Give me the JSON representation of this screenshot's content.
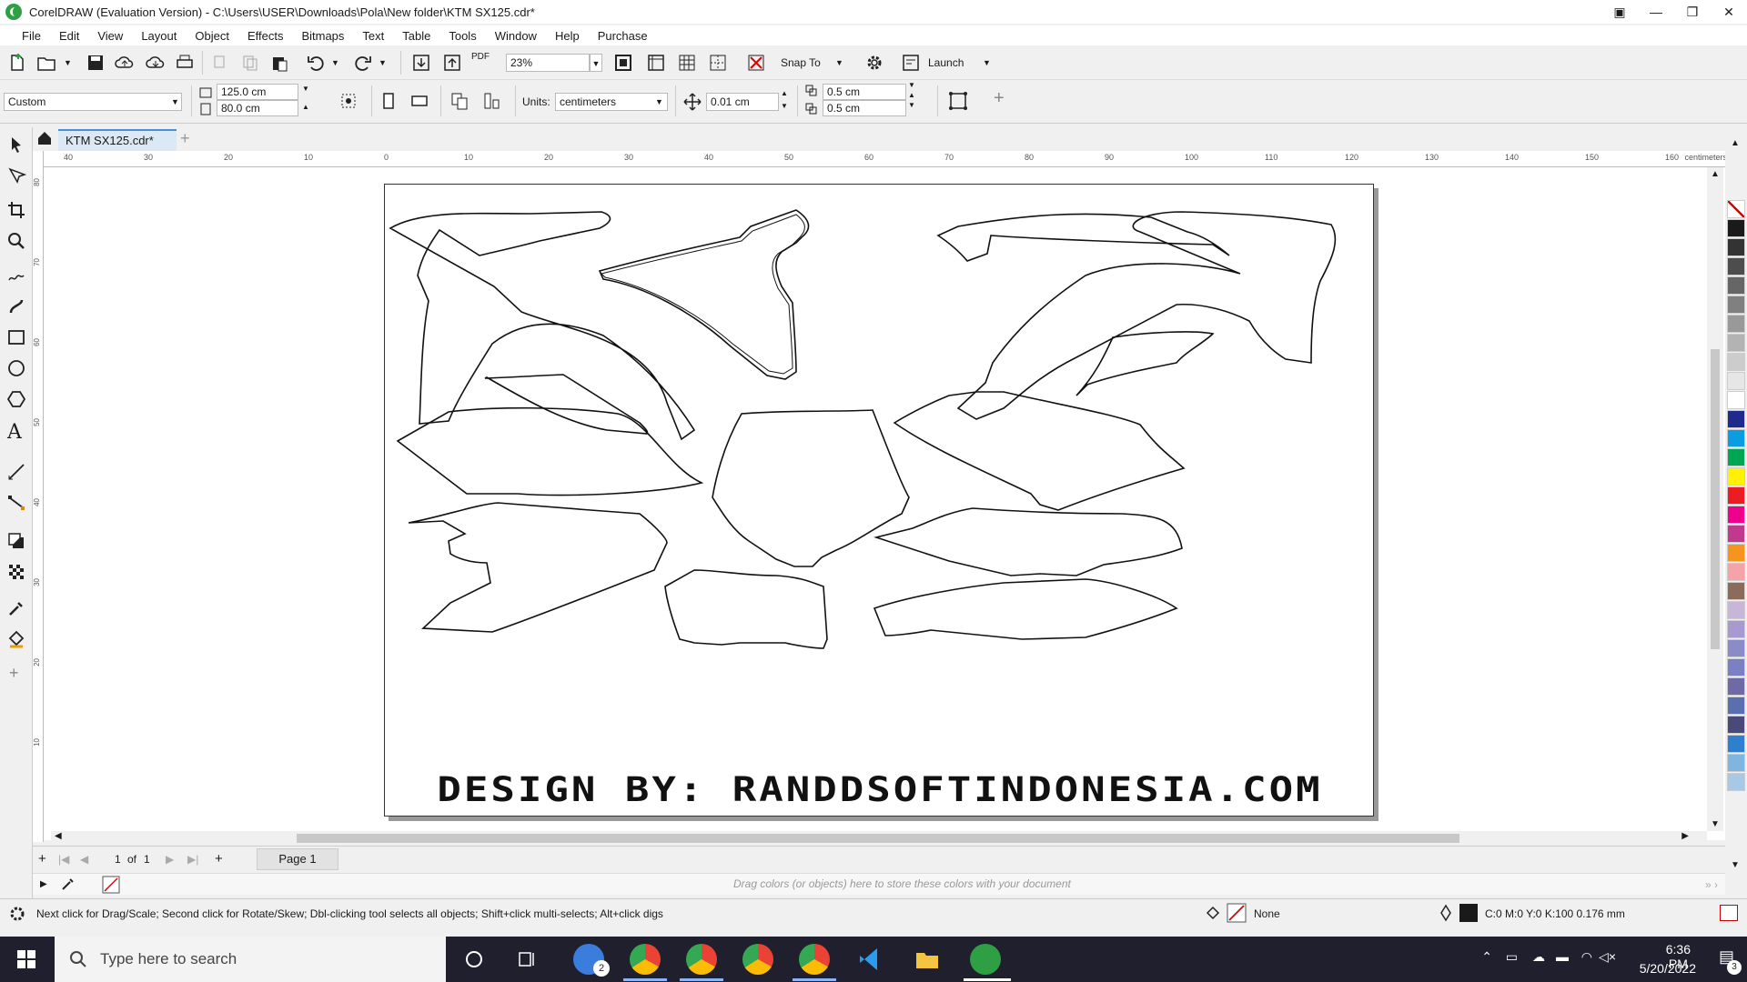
{
  "window": {
    "title": "CorelDRAW (Evaluation Version) - C:\\Users\\USER\\Downloads\\Pola\\New folder\\KTM SX125.cdr*"
  },
  "menu": [
    "File",
    "Edit",
    "View",
    "Layout",
    "Object",
    "Effects",
    "Bitmaps",
    "Text",
    "Table",
    "Tools",
    "Window",
    "Help",
    "Purchase"
  ],
  "toolbar1": {
    "zoom": "23%",
    "snap_label": "Snap To",
    "launch_label": "Launch",
    "pdf_label": "PDF"
  },
  "toolbar2": {
    "page_preset": "Custom",
    "width": "125.0 cm",
    "height": "80.0 cm",
    "units_label": "Units:",
    "units_value": "centimeters",
    "nudge": "0.01 cm",
    "dup_x": "0.5 cm",
    "dup_y": "0.5 cm"
  },
  "doc_tab": "KTM SX125.cdr*",
  "ruler_top_ticks": [
    "40",
    "30",
    "20",
    "10",
    "0",
    "10",
    "20",
    "30",
    "40",
    "50",
    "60",
    "70",
    "80",
    "90",
    "100",
    "110",
    "120",
    "130",
    "140",
    "150",
    "160"
  ],
  "ruler_unit": "centimeters",
  "ruler_left_ticks": [
    "80",
    "70",
    "60",
    "50",
    "40",
    "30",
    "20",
    "10"
  ],
  "page_text": "DESIGN BY: RANDDSOFTINDONESIA.COM",
  "page_nav": {
    "current": "1",
    "of": "of",
    "total": "1",
    "page_tab": "Page 1"
  },
  "color_dock_hint": "Drag colors (or objects) here to store these colors with your document",
  "status": {
    "message": "Next click for Drag/Scale; Second click for Rotate/Skew; Dbl-clicking tool selects all objects; Shift+click multi-selects; Alt+click digs",
    "fill_label": "None",
    "outline_label": "C:0 M:0 Y:0 K:100  0.176 mm"
  },
  "taskbar": {
    "search_placeholder": "Type here to search",
    "badge_count": "2",
    "time": "6:36 PM",
    "date": "5/20/2022",
    "notif_count": "3"
  },
  "palette_colors": [
    "#ffffff",
    "#1a1a1a",
    "#333333",
    "#4d4d4d",
    "#666666",
    "#808080",
    "#999999",
    "#b3b3b3",
    "#cccccc",
    "#e6e6e6",
    "#ffffff",
    "#1e2a8c",
    "#0b9de0",
    "#00a651",
    "#fff200",
    "#ed1c24",
    "#ec008c",
    "#c0398f",
    "#f7941d",
    "#f5a3a8",
    "#8b6b5a",
    "#c8b6d8",
    "#a89ad0",
    "#8a8bc8",
    "#7b7fc4",
    "#6f6aa5",
    "#5a6fb0",
    "#4a4a7a",
    "#2f7fd0",
    "#7fb6e0",
    "#a8c8e6"
  ]
}
